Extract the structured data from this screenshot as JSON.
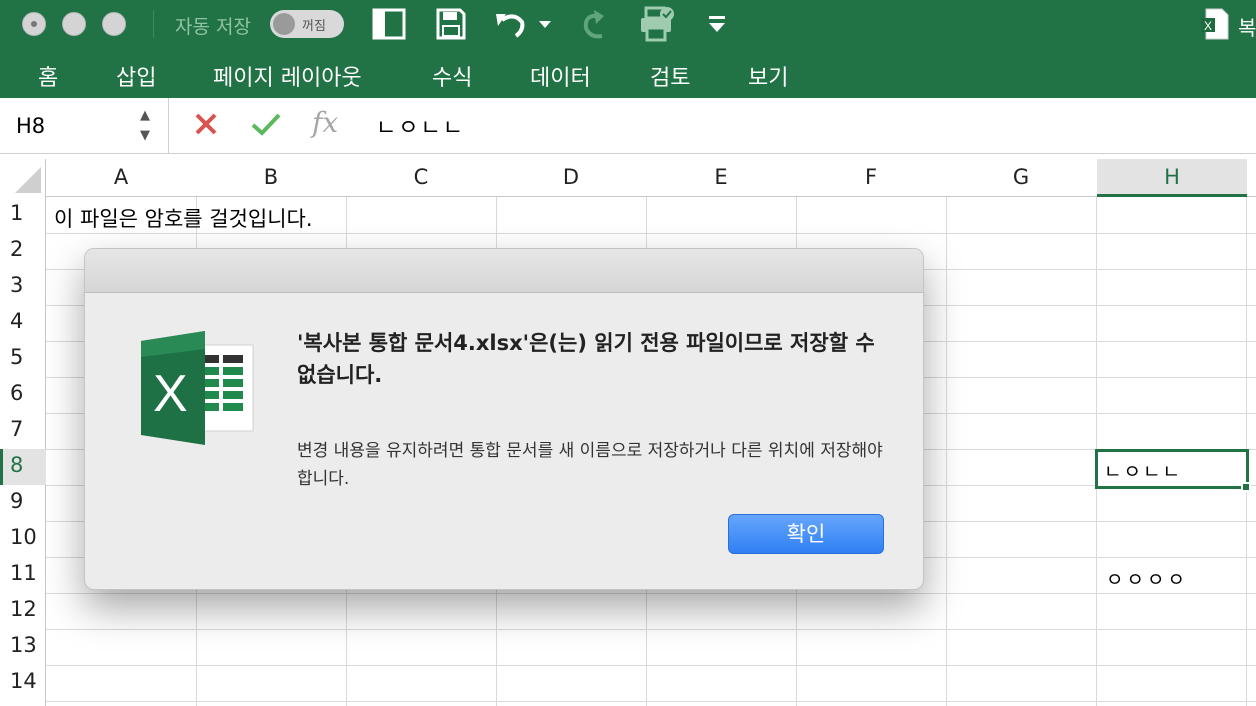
{
  "titlebar": {
    "autosave_label": "자동 저장",
    "autosave_state": "꺼짐",
    "document_title": "복"
  },
  "ribbon": {
    "tabs": [
      "홈",
      "삽입",
      "페이지 레이아웃",
      "수식",
      "데이터",
      "검토",
      "보기"
    ]
  },
  "formula_bar": {
    "name_box": "H8",
    "fx": "fx",
    "content": "ㄴㅇㄴㄴ"
  },
  "grid": {
    "columns": [
      "A",
      "B",
      "C",
      "D",
      "E",
      "F",
      "G",
      "H"
    ],
    "rows": [
      "1",
      "2",
      "3",
      "4",
      "5",
      "6",
      "7",
      "8",
      "9",
      "10",
      "11",
      "12",
      "13",
      "14"
    ],
    "selected_column": "H",
    "selected_row": "8",
    "cells": {
      "A1": "이 파일은 암호를 걸것입니다.",
      "H8": "ㄴㅇㄴㄴ",
      "H11": "ㅇㅇㅇㅇ"
    }
  },
  "dialog": {
    "title": "'복사본 통합 문서4.xlsx'은(는) 읽기 전용 파일이므로 저장할 수 없습니다.",
    "message": "변경 내용을 유지하려면 통합 문서를 새 이름으로 저장하거나 다른 위치에 저장해야 합니다.",
    "ok_label": "확인"
  },
  "colors": {
    "excel_green": "#217346",
    "ok_button": "#2f7ff5"
  }
}
